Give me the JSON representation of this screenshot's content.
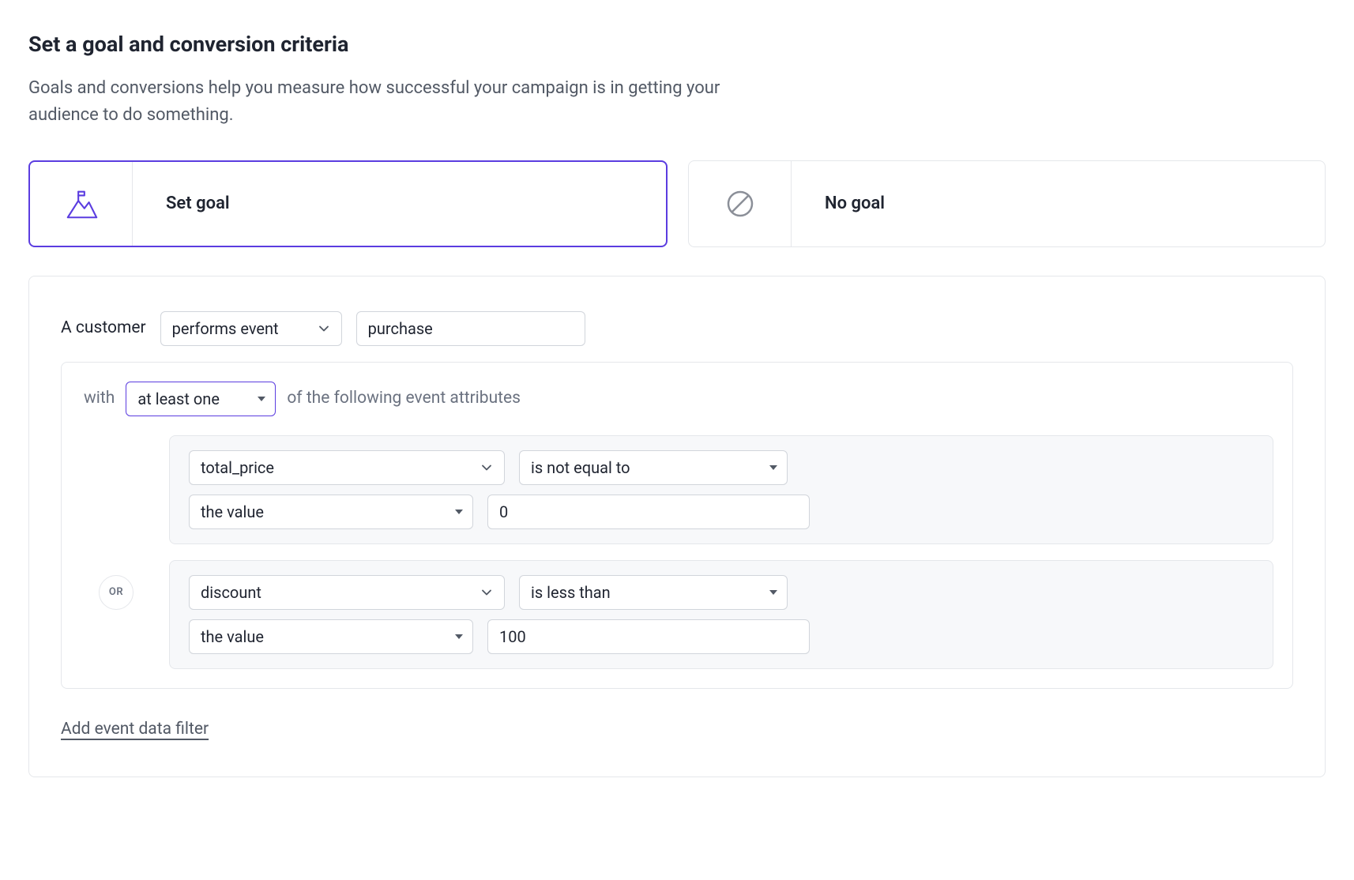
{
  "header": {
    "title": "Set a goal and conversion criteria",
    "description": "Goals and conversions help you measure how successful your campaign is in getting your audience to do something."
  },
  "goal_tiles": {
    "set_goal": {
      "label": "Set goal",
      "selected": true
    },
    "no_goal": {
      "label": "No goal",
      "selected": false
    }
  },
  "criteria": {
    "lead_text": "A customer",
    "action_select": "performs event",
    "event_name": "purchase",
    "attrs": {
      "with_label": "with",
      "quantifier": "at least one",
      "trailing": "of the following event attributes",
      "join_label": "OR",
      "filters": [
        {
          "attribute": "total_price",
          "operator": "is not equal to",
          "value_type": "the value",
          "value": "0"
        },
        {
          "attribute": "discount",
          "operator": "is less than",
          "value_type": "the value",
          "value": "100"
        }
      ]
    },
    "add_filter_label": "Add event data filter"
  },
  "colors": {
    "accent": "#5b3de0"
  }
}
